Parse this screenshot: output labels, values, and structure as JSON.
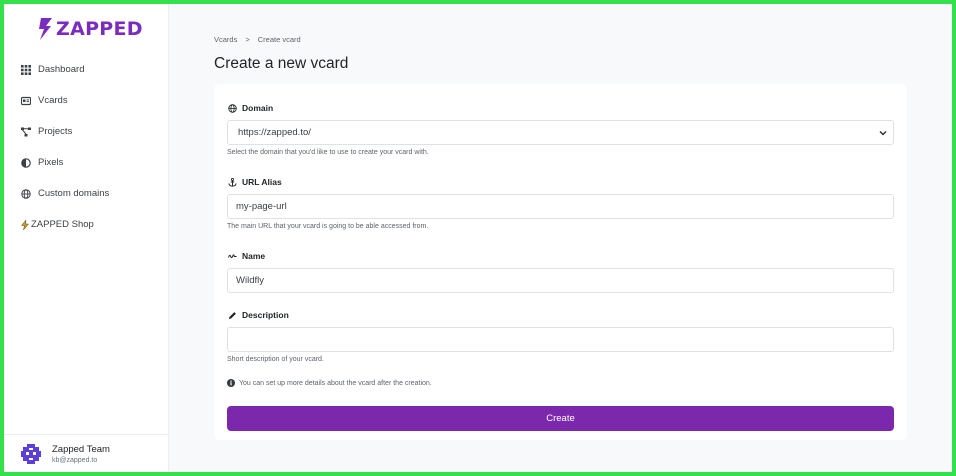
{
  "brand": {
    "name": "ZAPPED",
    "color": "#7b2cbf"
  },
  "sidebar": {
    "items": [
      {
        "label": "Dashboard",
        "icon": "grid-icon"
      },
      {
        "label": "Vcards",
        "icon": "id-card-icon"
      },
      {
        "label": "Projects",
        "icon": "project-diagram-icon"
      },
      {
        "label": "Pixels",
        "icon": "adjust-icon"
      },
      {
        "label": "Custom domains",
        "icon": "globe-icon"
      },
      {
        "label": "ZAPPED Shop",
        "icon": "bolt-icon"
      }
    ]
  },
  "user": {
    "name": "Zapped Team",
    "email": "kb@zapped.to"
  },
  "breadcrumb": {
    "parent": "Vcards",
    "separator": ">",
    "current": "Create vcard"
  },
  "page_title": "Create a new vcard",
  "form": {
    "domain": {
      "label": "Domain",
      "value": "https://zapped.to/",
      "help": "Select the domain that you'd like to use to create your vcard with."
    },
    "url_alias": {
      "label": "URL Alias",
      "value": "my-page-url",
      "help": "The main URL that your vcard is going to be able accessed from."
    },
    "name": {
      "label": "Name",
      "value": "Wildfly"
    },
    "description": {
      "label": "Description",
      "value": "",
      "help": "Short description of your vcard."
    },
    "info": "You can set up more details about the vcard after the creation.",
    "submit_label": "Create"
  },
  "colors": {
    "accent": "#7b28ad",
    "frame": "#35e04d"
  }
}
